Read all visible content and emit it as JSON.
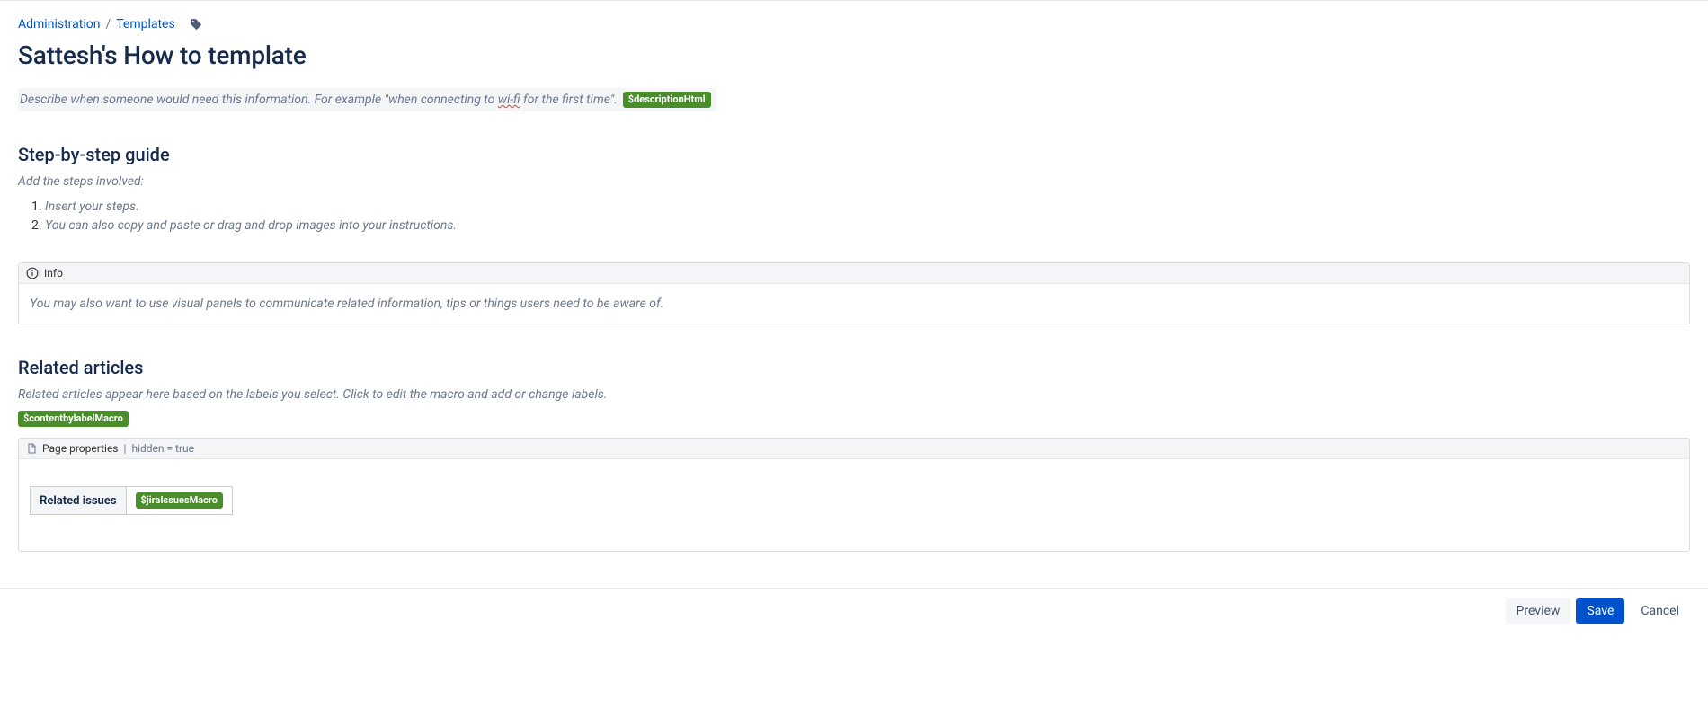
{
  "breadcrumb": {
    "administration": "Administration",
    "templates": "Templates"
  },
  "page_title": "Sattesh's How to template",
  "description": {
    "prefix": "Describe when someone would need this information. For example \"when connecting to ",
    "misspelled": "wi-fi",
    "suffix": " for the first time\".",
    "macro": "$descriptionHtml"
  },
  "step_section": {
    "heading": "Step-by-step guide",
    "intro": "Add the steps involved:",
    "items": [
      "Insert your steps.",
      "You can also copy and paste or drag and drop images into your instructions."
    ]
  },
  "info_panel": {
    "label": "Info",
    "body": "You may also want to use visual panels to communicate related information, tips or things users need to be aware of."
  },
  "related": {
    "heading": "Related articles",
    "intro": "Related articles appear here based on the labels you select. Click to edit the macro and add or change labels.",
    "macro": "$contentbylabelMacro"
  },
  "page_properties": {
    "label": "Page properties",
    "params": "hidden = true",
    "table_header": "Related issues",
    "jira_macro": "$jiraIssuesMacro"
  },
  "footer": {
    "preview": "Preview",
    "save": "Save",
    "cancel": "Cancel"
  }
}
